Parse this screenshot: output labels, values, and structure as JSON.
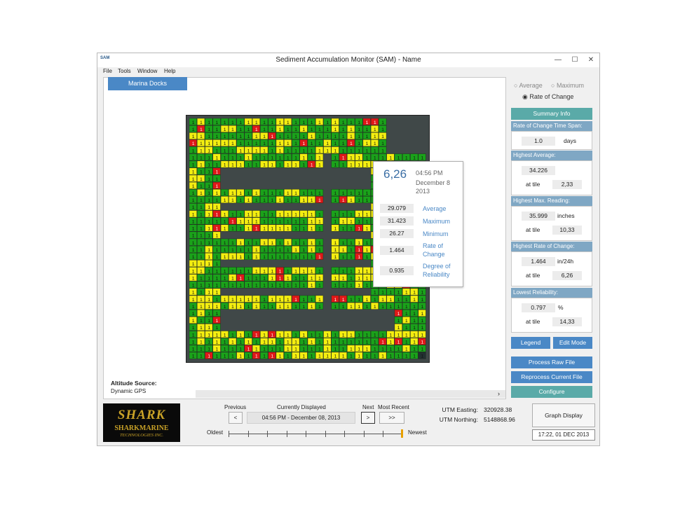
{
  "window": {
    "title": "Sediment Accumulation Monitor (SAM) - Name",
    "icon_text": "SAM",
    "minimize": "—",
    "maximize": "☐",
    "close": "✕",
    "menu": [
      "File",
      "Tools",
      "Window",
      "Help"
    ]
  },
  "map": {
    "tab_label": "Marina Docks",
    "cell_value": "1",
    "colors": {
      "green": "#1aa21a",
      "yellow": "#f4ee10",
      "red": "#e01818",
      "dark": "#223030"
    }
  },
  "popup": {
    "tile": "6,26",
    "time": "04:56 PM",
    "date": "December 8 2013",
    "rows": [
      {
        "value": "29.079",
        "label": "Average"
      },
      {
        "value": "31.423",
        "label": "Maximum"
      },
      {
        "value": "26.27",
        "label": "Minimum"
      },
      {
        "value": "1.464",
        "label": "Rate of Change"
      },
      {
        "value": "0.935",
        "label": "Degree of Reliability"
      }
    ]
  },
  "altitude": {
    "label": "Altitude Source:",
    "value": "Dynamic GPS"
  },
  "mode": {
    "options": [
      "Average",
      "Maximum",
      "Rate of Change"
    ],
    "selected": "Rate of Change"
  },
  "summary": {
    "tab_label": "Summary Info",
    "rate_span": {
      "header": "Rate of Change Time Span:",
      "value": "1.0",
      "unit": "days"
    },
    "highest_average": {
      "header": "Highest Average:",
      "value": "34.226",
      "tile_label": "at tile",
      "tile": "2,33"
    },
    "highest_max": {
      "header": "Highest Max. Reading:",
      "value": "35.999",
      "unit": "inches",
      "tile_label": "at tile",
      "tile": "10,33"
    },
    "highest_rate": {
      "header": "Highest Rate of Change:",
      "value": "1.464",
      "unit": "in/24h",
      "tile_label": "at tile",
      "tile": "6,26"
    },
    "lowest_reliability": {
      "header": "Lowest Reliability:",
      "value": "0.797",
      "unit": "%",
      "tile_label": "at tile",
      "tile": "14,33"
    }
  },
  "buttons": {
    "legend": "Legend",
    "edit_mode": "Edit Mode",
    "process_raw": "Process Raw File",
    "reprocess": "Reprocess Current File",
    "configure": "Configure"
  },
  "nav": {
    "previous_label": "Previous",
    "current_label": "Currently Displayed",
    "next_label": "Next",
    "most_recent_label": "Most Recent",
    "prev_btn": "<",
    "next_btn": ">",
    "most_recent_btn": ">>",
    "current_value": "04:56 PM - December 08, 2013",
    "oldest": "Oldest",
    "newest": "Newest",
    "timeline_position": 1.0,
    "ticks": 10
  },
  "utm": {
    "easting_label": "UTM Easting:",
    "easting": "320928.38",
    "northing_label": "UTM Northing:",
    "northing": "5148868.96"
  },
  "graph_button": "Graph Display",
  "clock": "17:22, 01 DEC 2013",
  "logo": {
    "big": "SHARK",
    "line1": "SHARKMARINE",
    "line2": "TECHNOLOGIES INC."
  }
}
